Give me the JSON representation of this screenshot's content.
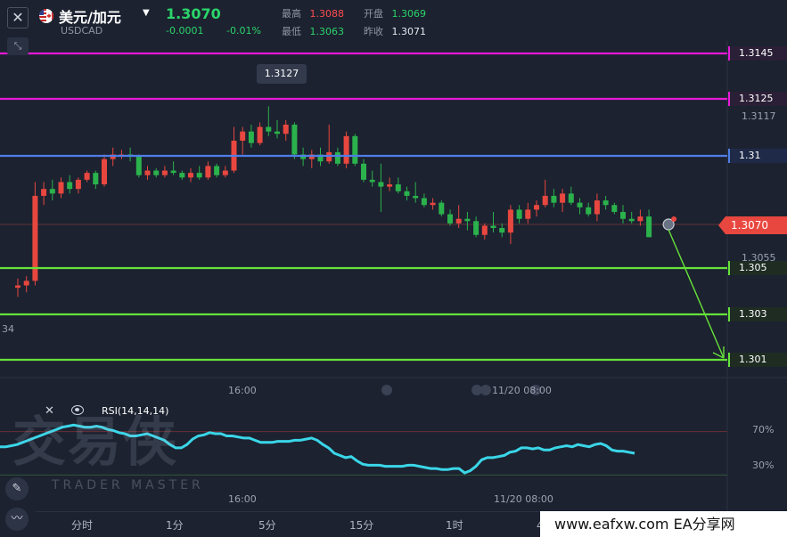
{
  "header": {
    "symbol_name": "美元/加元",
    "symbol_code": "USDCAD",
    "last_price": "1.3070",
    "change": "-0.0001",
    "change_pct": "-0.01%",
    "stats": {
      "high_label": "最高",
      "high": "1.3088",
      "open_label": "开盘",
      "open": "1.3069",
      "low_label": "最低",
      "low": "1.3063",
      "prev_label": "昨收",
      "prev": "1.3071"
    }
  },
  "price_levels": [
    {
      "label": "1.3145",
      "color": "#e81ad8"
    },
    {
      "label": "1.3125",
      "color": "#e81ad8"
    },
    {
      "label": "1.31",
      "color": "#4f7ee8"
    },
    {
      "label": "1.305",
      "color": "#66e23a"
    },
    {
      "label": "1.303",
      "color": "#66e23a"
    },
    {
      "label": "1.301",
      "color": "#66e23a"
    }
  ],
  "axis": {
    "right_high_tick": "1.3117",
    "right_low_tick": "1.3055",
    "left_cut_tick": "34",
    "time_top": [
      "16:00",
      "11/20 08:00"
    ],
    "time_bottom": [
      "16:00",
      "11/20 08:00"
    ]
  },
  "peak_label": "1.3127",
  "last_price_tag": "1.3070",
  "indicator": {
    "name": "RSI(14,14,14)",
    "levels": [
      "70%",
      "30%"
    ]
  },
  "watermark": {
    "main": "交易侠",
    "sub": "TRADER MASTER"
  },
  "timeframes": [
    "分时",
    "1分",
    "5分",
    "15分",
    "1时",
    "4时"
  ],
  "footer_site": "www.eafxw.com  EA分享网",
  "colors": {
    "up": "#e8473f",
    "down": "#2bb24c",
    "rsi_line": "#3ad6e8",
    "background": "#1c2230"
  },
  "chart_data": {
    "type": "candlestick",
    "series": [
      {
        "name": "USDCAD",
        "ohlc": [
          [
            1.3048,
            1.3052,
            1.3044,
            1.3049
          ],
          [
            1.3049,
            1.3053,
            1.3046,
            1.3051
          ],
          [
            1.3051,
            1.3094,
            1.3049,
            1.3088
          ],
          [
            1.3088,
            1.3094,
            1.3084,
            1.3091
          ],
          [
            1.3091,
            1.3095,
            1.3086,
            1.3089
          ],
          [
            1.3089,
            1.3096,
            1.3087,
            1.3094
          ],
          [
            1.3094,
            1.3097,
            1.3089,
            1.3091
          ],
          [
            1.3091,
            1.3096,
            1.3089,
            1.3095
          ],
          [
            1.3095,
            1.3099,
            1.3094,
            1.3098
          ],
          [
            1.3098,
            1.3099,
            1.3091,
            1.3093
          ],
          [
            1.3093,
            1.3106,
            1.3092,
            1.3104
          ],
          [
            1.3104,
            1.3109,
            1.3101,
            1.3106
          ],
          [
            1.3106,
            1.3108,
            1.3104,
            1.3106
          ],
          [
            1.3106,
            1.3109,
            1.3103,
            1.3105
          ],
          [
            1.3105,
            1.3106,
            1.3096,
            1.3097
          ],
          [
            1.3097,
            1.3101,
            1.3095,
            1.3099
          ],
          [
            1.3099,
            1.31,
            1.3096,
            1.3097
          ],
          [
            1.3097,
            1.3101,
            1.3096,
            1.3099
          ],
          [
            1.3099,
            1.3103,
            1.3097,
            1.3098
          ],
          [
            1.3098,
            1.3099,
            1.3095,
            1.3096
          ],
          [
            1.3096,
            1.31,
            1.3094,
            1.3098
          ],
          [
            1.3098,
            1.3101,
            1.3095,
            1.3096
          ],
          [
            1.3096,
            1.3103,
            1.3095,
            1.3101
          ],
          [
            1.3101,
            1.3102,
            1.3096,
            1.3097
          ],
          [
            1.3097,
            1.3101,
            1.3096,
            1.3099
          ],
          [
            1.3099,
            1.3118,
            1.3098,
            1.3112
          ],
          [
            1.3112,
            1.3118,
            1.3106,
            1.3116
          ],
          [
            1.3116,
            1.3119,
            1.3109,
            1.3111
          ],
          [
            1.3111,
            1.312,
            1.311,
            1.3118
          ],
          [
            1.3118,
            1.3127,
            1.3114,
            1.3116
          ],
          [
            1.3116,
            1.3121,
            1.3113,
            1.3115
          ],
          [
            1.3115,
            1.3121,
            1.3112,
            1.3119
          ],
          [
            1.3119,
            1.312,
            1.3104,
            1.3106
          ],
          [
            1.3106,
            1.3109,
            1.3101,
            1.3104
          ],
          [
            1.3104,
            1.3108,
            1.31,
            1.3106
          ],
          [
            1.3106,
            1.3109,
            1.3101,
            1.3103
          ],
          [
            1.3103,
            1.3119,
            1.3102,
            1.3107
          ],
          [
            1.3107,
            1.3109,
            1.3101,
            1.3102
          ],
          [
            1.3102,
            1.3116,
            1.31,
            1.3114
          ],
          [
            1.3114,
            1.3115,
            1.3101,
            1.3102
          ],
          [
            1.3102,
            1.3104,
            1.3094,
            1.3095
          ],
          [
            1.3095,
            1.3099,
            1.3092,
            1.3094
          ],
          [
            1.3094,
            1.3102,
            1.3081,
            1.3092
          ],
          [
            1.3092,
            1.3096,
            1.309,
            1.3093
          ],
          [
            1.3093,
            1.3096,
            1.3089,
            1.309
          ],
          [
            1.309,
            1.3092,
            1.3086,
            1.3088
          ],
          [
            1.3088,
            1.3094,
            1.3085,
            1.3087
          ],
          [
            1.3087,
            1.3089,
            1.3083,
            1.3084
          ],
          [
            1.3084,
            1.3087,
            1.3082,
            1.3085
          ],
          [
            1.3085,
            1.3086,
            1.3079,
            1.308
          ],
          [
            1.308,
            1.3082,
            1.3075,
            1.3076
          ],
          [
            1.3076,
            1.3084,
            1.3074,
            1.3078
          ],
          [
            1.3078,
            1.3081,
            1.3073,
            1.3077
          ],
          [
            1.3077,
            1.3079,
            1.307,
            1.3071
          ],
          [
            1.3071,
            1.3076,
            1.3069,
            1.3075
          ],
          [
            1.3075,
            1.3081,
            1.3072,
            1.3074
          ],
          [
            1.3074,
            1.3076,
            1.307,
            1.3072
          ],
          [
            1.3072,
            1.3084,
            1.3067,
            1.3082
          ],
          [
            1.3082,
            1.3084,
            1.3076,
            1.3078
          ],
          [
            1.3078,
            1.3085,
            1.3076,
            1.3082
          ],
          [
            1.3082,
            1.3086,
            1.3079,
            1.3084
          ],
          [
            1.3084,
            1.3095,
            1.3083,
            1.3088
          ],
          [
            1.3088,
            1.3091,
            1.3083,
            1.3085
          ],
          [
            1.3085,
            1.3091,
            1.3081,
            1.3089
          ],
          [
            1.3089,
            1.3092,
            1.3084,
            1.3085
          ],
          [
            1.3085,
            1.3087,
            1.308,
            1.3083
          ],
          [
            1.3083,
            1.3085,
            1.3079,
            1.308
          ],
          [
            1.308,
            1.3089,
            1.3077,
            1.3086
          ],
          [
            1.3086,
            1.3088,
            1.3082,
            1.3084
          ],
          [
            1.3084,
            1.3085,
            1.308,
            1.3081
          ],
          [
            1.3081,
            1.3084,
            1.3076,
            1.3078
          ],
          [
            1.3078,
            1.3081,
            1.3076,
            1.3077
          ],
          [
            1.3077,
            1.3082,
            1.3075,
            1.3079
          ],
          [
            1.3079,
            1.3082,
            1.307,
            1.307
          ]
        ]
      }
    ],
    "x_ticks": [
      "16:00",
      "11/20 08:00"
    ],
    "ylim": [
      1.3,
      1.3152
    ],
    "indicator": {
      "name": "RSI(14,14,14)",
      "levels": [
        70,
        30
      ],
      "values": [
        56,
        56,
        57,
        58,
        60,
        62,
        64,
        66,
        68,
        70,
        72,
        74,
        75,
        76,
        75,
        74,
        74,
        75,
        74,
        72,
        71,
        69,
        68,
        66,
        66,
        67,
        68,
        66,
        64,
        62,
        58,
        55,
        55,
        58,
        63,
        66,
        67,
        69,
        68,
        68,
        66,
        66,
        65,
        64,
        64,
        62,
        60,
        60,
        60,
        61,
        61,
        61,
        62,
        62,
        63,
        64,
        62,
        58,
        55,
        50,
        48,
        46,
        47,
        43,
        40,
        39,
        39,
        39,
        38,
        38,
        38,
        38,
        39,
        39,
        38,
        37,
        36,
        36,
        35,
        35,
        36,
        36,
        32,
        34,
        38,
        44,
        46,
        46,
        47,
        48,
        51,
        52,
        55,
        55,
        54,
        55,
        53,
        53,
        55,
        56,
        57,
        56,
        58,
        57,
        56,
        58,
        59,
        57,
        53,
        52,
        52,
        51,
        50
      ]
    }
  }
}
